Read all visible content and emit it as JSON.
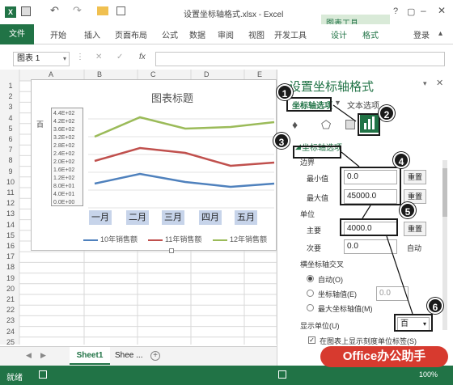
{
  "title": "设置坐标轴格式.xlsx - Excel",
  "question_mark": "?",
  "user": "登录",
  "chart_tools_label": "图表工具",
  "tabs": [
    "文件",
    "开始",
    "插入",
    "页面布局",
    "公式",
    "数据",
    "审阅",
    "视图",
    "开发工具",
    "设计",
    "格式"
  ],
  "name_box": "图表 1",
  "fx": "fx",
  "columns": [
    "A",
    "B",
    "C",
    "D",
    "E"
  ],
  "rows": [
    "1",
    "2",
    "3",
    "4",
    "5",
    "6",
    "7",
    "8",
    "9",
    "10",
    "11",
    "12",
    "13",
    "14",
    "15",
    "16",
    "17",
    "18",
    "19",
    "20",
    "21",
    "22",
    "23",
    "24",
    "25"
  ],
  "chart": {
    "title": "图表标题",
    "months": [
      "一月",
      "二月",
      "三月",
      "四月",
      "五月"
    ],
    "axis_labels": [
      "4.4E+02",
      "4.2E+02",
      "3.6E+02",
      "3.2E+02",
      "2.8E+02",
      "2.4E+02",
      "2.0E+02",
      "1.6E+02",
      "1.2E+02",
      "8.0E+01",
      "4.0E+01",
      "0.0E+00"
    ],
    "legend": [
      "10年销售额",
      "11年销售额",
      "12年销售额"
    ],
    "series_colors": [
      "#4f81bd",
      "#c0504d",
      "#9bbb59"
    ]
  },
  "pane": {
    "title": "设置坐标轴格式",
    "tab_axis": "坐标轴选项",
    "tab_text": "文本选项",
    "section": "坐标轴选项",
    "bounds": "边界",
    "min_label": "最小值",
    "min_value": "0.0",
    "max_label": "最大值",
    "max_value": "45000.0",
    "reset": "重置",
    "units": "单位",
    "major_label": "主要",
    "major_value": "4000.0",
    "minor_label": "次要",
    "minor_value": "0.0",
    "auto": "自动",
    "cross_label": "横坐标轴交叉",
    "opt_auto": "自动(O)",
    "opt_value": "坐标轴值(E)",
    "opt_value_num": "0.0",
    "opt_max": "最大坐标轴值(M)",
    "display_units": "显示单位(U)",
    "display_units_value": "百",
    "show_label": "在图表上显示刻度单位标签(S)"
  },
  "sheets": [
    "Sheet1",
    "Shee ..."
  ],
  "status": "就绪",
  "watermark": "Office办公助手",
  "zoom": "100%",
  "callouts": [
    "1",
    "2",
    "3",
    "4",
    "5",
    "6"
  ]
}
